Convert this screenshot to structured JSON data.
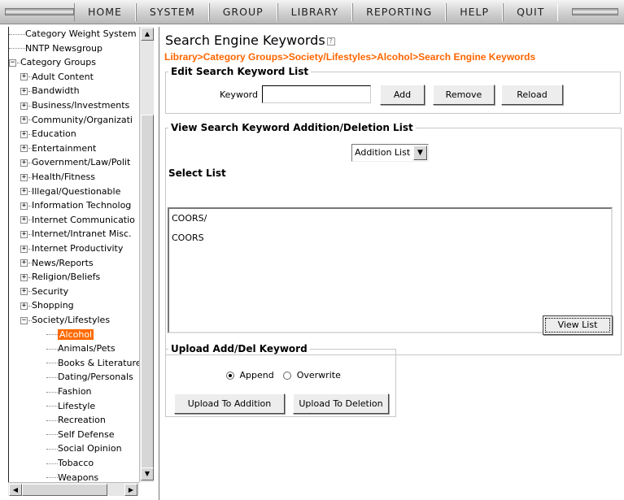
{
  "menu": [
    "HOME",
    "SYSTEM",
    "GROUP",
    "LIBRARY",
    "REPORTING",
    "HELP",
    "QUIT"
  ],
  "tree": {
    "items": [
      {
        "label": "Category Weight System",
        "level": 0,
        "toggle": ""
      },
      {
        "label": "NNTP Newsgroup",
        "level": 0,
        "toggle": ""
      },
      {
        "label": "Category Groups",
        "level": 0,
        "toggle": "−"
      },
      {
        "label": "Adult Content",
        "level": 1,
        "toggle": "+"
      },
      {
        "label": "Bandwidth",
        "level": 1,
        "toggle": "+"
      },
      {
        "label": "Business/Investments",
        "level": 1,
        "toggle": "+"
      },
      {
        "label": "Community/Organizati",
        "level": 1,
        "toggle": "+"
      },
      {
        "label": "Education",
        "level": 1,
        "toggle": "+"
      },
      {
        "label": "Entertainment",
        "level": 1,
        "toggle": "+"
      },
      {
        "label": "Government/Law/Polit",
        "level": 1,
        "toggle": "+"
      },
      {
        "label": "Health/Fitness",
        "level": 1,
        "toggle": "+"
      },
      {
        "label": "Illegal/Questionable",
        "level": 1,
        "toggle": "+"
      },
      {
        "label": "Information Technolog",
        "level": 1,
        "toggle": "+"
      },
      {
        "label": "Internet Communicatio",
        "level": 1,
        "toggle": "+"
      },
      {
        "label": "Internet/Intranet Misc.",
        "level": 1,
        "toggle": "+"
      },
      {
        "label": "Internet Productivity",
        "level": 1,
        "toggle": "+"
      },
      {
        "label": "News/Reports",
        "level": 1,
        "toggle": "+"
      },
      {
        "label": "Religion/Beliefs",
        "level": 1,
        "toggle": "+"
      },
      {
        "label": "Security",
        "level": 1,
        "toggle": "+"
      },
      {
        "label": "Shopping",
        "level": 1,
        "toggle": "+"
      },
      {
        "label": "Society/Lifestyles",
        "level": 1,
        "toggle": "−"
      },
      {
        "label": "Alcohol",
        "level": 2,
        "toggle": "",
        "selected": true
      },
      {
        "label": "Animals/Pets",
        "level": 2,
        "toggle": ""
      },
      {
        "label": "Books & Literature",
        "level": 2,
        "toggle": ""
      },
      {
        "label": "Dating/Personals",
        "level": 2,
        "toggle": ""
      },
      {
        "label": "Fashion",
        "level": 2,
        "toggle": ""
      },
      {
        "label": "Lifestyle",
        "level": 2,
        "toggle": ""
      },
      {
        "label": "Recreation",
        "level": 2,
        "toggle": ""
      },
      {
        "label": "Self Defense",
        "level": 2,
        "toggle": ""
      },
      {
        "label": "Social Opinion",
        "level": 2,
        "toggle": ""
      },
      {
        "label": "Tobacco",
        "level": 2,
        "toggle": ""
      },
      {
        "label": "Weapons",
        "level": 2,
        "toggle": ""
      }
    ]
  },
  "main": {
    "title": "Search Engine Keywords",
    "help_icon": "?",
    "breadcrumb": "Library>Category Groups>Society/Lifestyles>Alcohol>Search Engine Keywords",
    "edit_group": {
      "legend": "Edit Search Keyword List",
      "keyword_label": "Keyword",
      "keyword_value": "",
      "add_label": "Add",
      "remove_label": "Remove",
      "reload_label": "Reload"
    },
    "view_group": {
      "legend": "View Search Keyword Addition/Deletion List",
      "list_type": "Addition List",
      "select_list_label": "Select List",
      "items": [
        "COORS/",
        "COORS"
      ],
      "view_list_label": "View List"
    },
    "upload_group": {
      "legend": "Upload Add/Del Keyword",
      "append_label": "Append",
      "overwrite_label": "Overwrite",
      "selected_mode": "append",
      "upload_addition_label": "Upload To Addition",
      "upload_deletion_label": "Upload To Deletion"
    }
  },
  "colors": {
    "accent": "#ff6600",
    "selected_bg": "#ff6a00"
  },
  "icons": {
    "help": "help-icon",
    "scroll_up": "arrow-up-icon",
    "scroll_down": "arrow-down-icon",
    "scroll_left": "arrow-left-icon",
    "scroll_right": "arrow-right-icon",
    "dropdown": "chevron-down-icon"
  }
}
